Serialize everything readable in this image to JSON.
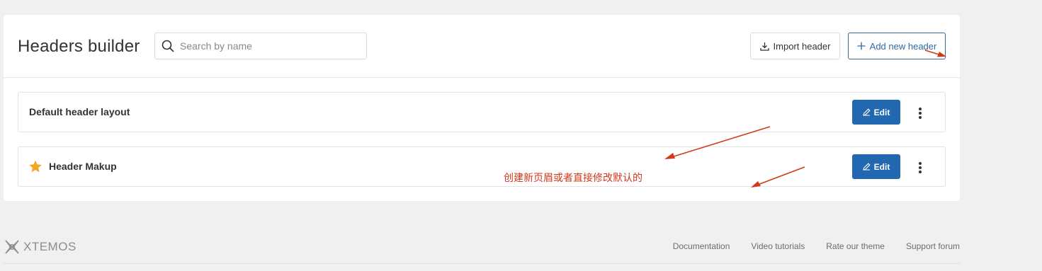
{
  "header": {
    "title": "Headers builder",
    "search_placeholder": "Search by name",
    "import_label": "Import header",
    "add_label": "Add new header"
  },
  "headers": [
    {
      "name": "Default header layout",
      "starred": false,
      "edit_label": "Edit"
    },
    {
      "name": "Header Makup",
      "starred": true,
      "edit_label": "Edit"
    }
  ],
  "annotation": {
    "text": "创建新页眉或者直接修改默认的",
    "color": "#d0391a"
  },
  "footer": {
    "brand": "XTEMOS",
    "links": [
      "Documentation",
      "Video tutorials",
      "Rate our theme",
      "Support forum"
    ]
  },
  "colors": {
    "accent": "#2268b0",
    "star": "#f5a623",
    "background": "#f0f0f0"
  }
}
